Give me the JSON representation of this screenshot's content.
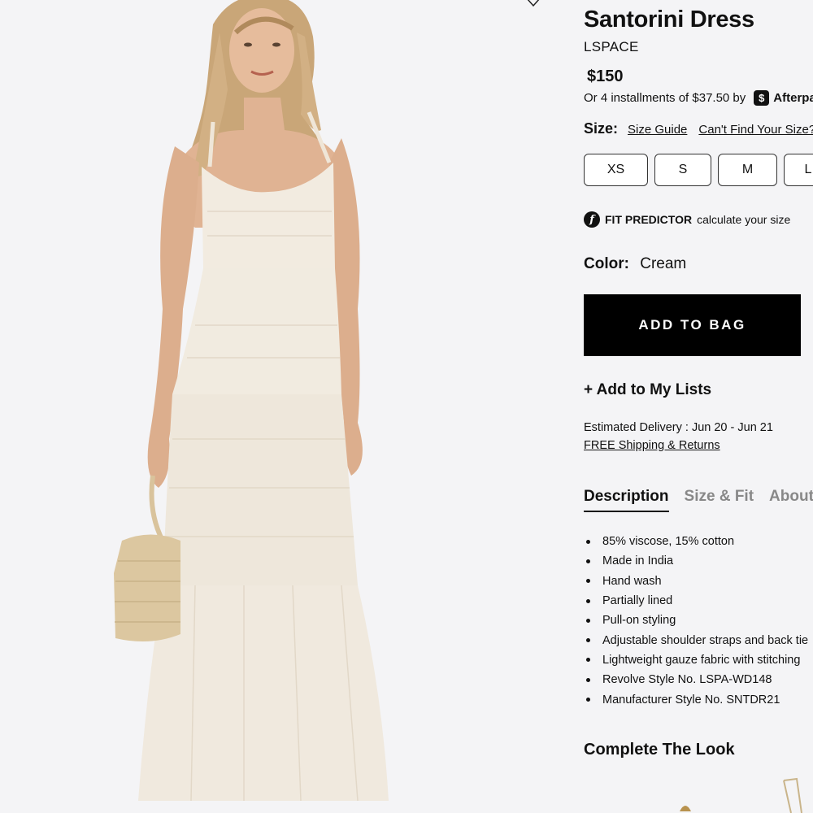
{
  "product": {
    "title": "Santorini Dress",
    "brand": "LSPACE",
    "price": "$150",
    "installments": "Or 4 installments of $37.50 by",
    "afterpay_label": "Afterpay",
    "afterpay_icon": "afterpay-logo-icon"
  },
  "size": {
    "label": "Size:",
    "guide_link": "Size Guide",
    "cant_find_link": "Can't Find Your Size?",
    "options": [
      "XS",
      "S",
      "M",
      "L"
    ]
  },
  "fit_predictor": {
    "icon": "fit-predictor-icon",
    "label": "FIT PREDICTOR",
    "sub": "calculate your size"
  },
  "color": {
    "label": "Color:",
    "value": "Cream"
  },
  "add_to_bag": "ADD TO BAG",
  "add_to_lists": "+ Add to My Lists",
  "delivery": "Estimated Delivery : Jun 20 - Jun 21",
  "shipping": "FREE Shipping & Returns",
  "tabs": [
    "Description",
    "Size & Fit",
    "About the Brand"
  ],
  "details": [
    "85% viscose, 15% cotton",
    "Made in India",
    "Hand wash",
    "Partially lined",
    "Pull-on styling",
    "Adjustable shoulder straps and back tie",
    "Lightweight gauze fabric with stitching",
    "Revolve Style No. LSPA-WD148",
    "Manufacturer Style No. SNTDR21"
  ],
  "complete_look": "Complete The Look",
  "colors": {
    "accent": "#000000",
    "background": "#f4f4f6"
  }
}
